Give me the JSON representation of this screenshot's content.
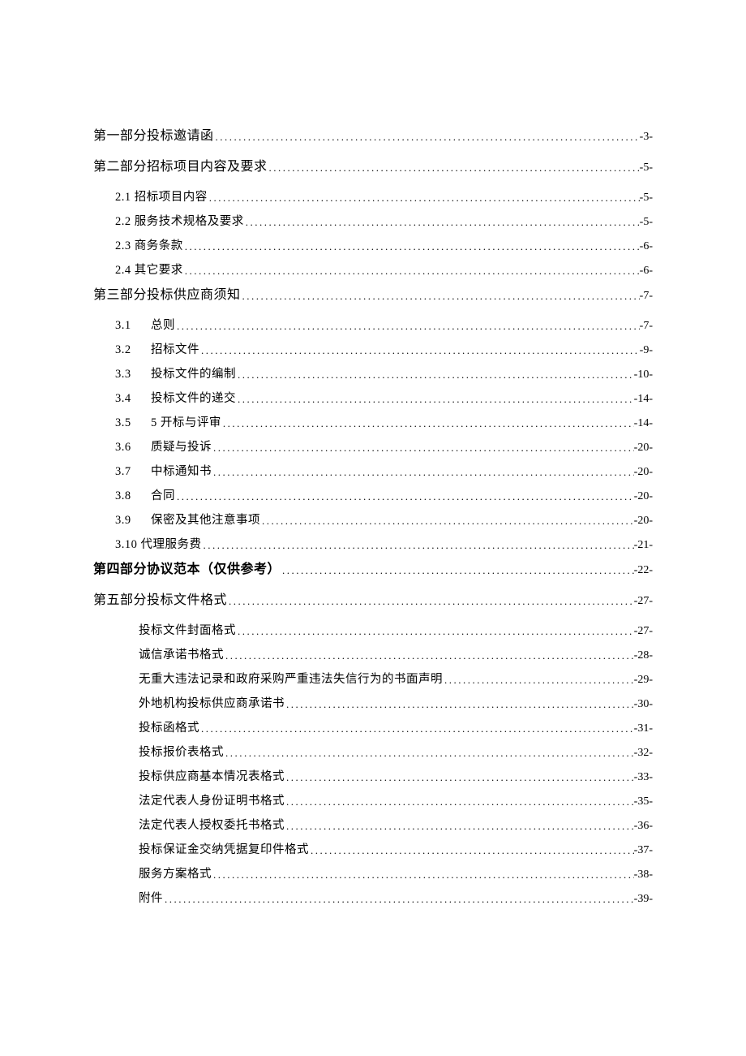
{
  "toc": [
    {
      "level": 0,
      "title": "第一部分投标邀请函",
      "page": "-3-"
    },
    {
      "level": 0,
      "title": "第二部分招标项目内容及要求",
      "page": "-5-"
    },
    {
      "level": 1,
      "num": "2.1",
      "title": "招标项目内容",
      "page": "-5-"
    },
    {
      "level": 1,
      "num": "2.2",
      "title": "服务技术规格及要求",
      "page": "-5-"
    },
    {
      "level": 1,
      "num": "2.3",
      "title": "商务条款",
      "page": "-6-"
    },
    {
      "level": 1,
      "num": "2.4",
      "title": "其它要求",
      "page": "-6-"
    },
    {
      "level": 0,
      "title": "第三部分投标供应商须知",
      "page": "-7-"
    },
    {
      "level": 1,
      "num": "3.1",
      "title": "总则",
      "page": "-7-",
      "wide": true
    },
    {
      "level": 1,
      "num": "3.2",
      "title": "招标文件",
      "page": "-9-",
      "wide": true
    },
    {
      "level": 1,
      "num": "3.3",
      "title": "投标文件的编制",
      "page": "-10-",
      "wide": true
    },
    {
      "level": 1,
      "num": "3.4",
      "title": "投标文件的递交",
      "page": "-14-",
      "wide": true
    },
    {
      "level": 1,
      "num": "3.5",
      "title": "5 开标与评审",
      "page": "-14-",
      "wide": true
    },
    {
      "level": 1,
      "num": "3.6",
      "title": "质疑与投诉",
      "page": "-20-",
      "wide": true
    },
    {
      "level": 1,
      "num": "3.7",
      "title": "中标通知书",
      "page": "-20-",
      "wide": true
    },
    {
      "level": 1,
      "num": "3.8",
      "title": "合同",
      "page": "-20-",
      "wide": true
    },
    {
      "level": 1,
      "num": "3.9",
      "title": "保密及其他注意事项",
      "page": "-20-",
      "wide": true
    },
    {
      "level": 1,
      "num": "3.10",
      "title": "代理服务费",
      "page": "-21-"
    },
    {
      "level": 0,
      "bold": true,
      "title": "第四部分协议范本（仅供参考）",
      "page": "-22-"
    },
    {
      "level": 0,
      "title": "第五部分投标文件格式",
      "page": "-27-"
    },
    {
      "level": 2,
      "title": "投标文件封面格式",
      "page": "-27-"
    },
    {
      "level": 2,
      "title": "诚信承诺书格式",
      "page": "-28-"
    },
    {
      "level": 2,
      "title": "无重大违法记录和政府采购严重违法失信行为的书面声明",
      "page": "-29-"
    },
    {
      "level": 2,
      "title": "外地机构投标供应商承诺书",
      "page": "-30-"
    },
    {
      "level": 2,
      "title": "投标函格式",
      "page": "-31-"
    },
    {
      "level": 2,
      "title": "投标报价表格式",
      "page": "-32-"
    },
    {
      "level": 2,
      "title": "投标供应商基本情况表格式",
      "page": "-33-"
    },
    {
      "level": 2,
      "title": "法定代表人身份证明书格式",
      "page": "-35-"
    },
    {
      "level": 2,
      "title": "法定代表人授权委托书格式",
      "page": "-36-"
    },
    {
      "level": 2,
      "title": "投标保证金交纳凭据复印件格式",
      "page": "-37-"
    },
    {
      "level": 2,
      "title": "服务方案格式",
      "page": "-38-"
    },
    {
      "level": 2,
      "title": "附件",
      "page": "-39-"
    }
  ]
}
